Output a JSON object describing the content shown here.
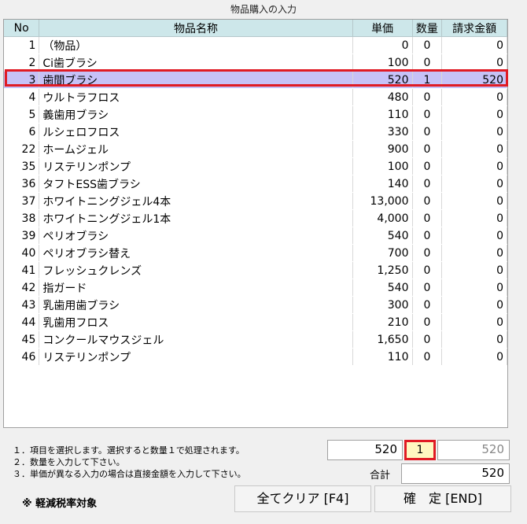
{
  "window": {
    "title": "物品購入の入力"
  },
  "grid": {
    "headers": {
      "no": "No",
      "name": "物品名称",
      "price": "単価",
      "qty": "数量",
      "amount": "請求金額"
    },
    "selected_index": 2,
    "rows": [
      {
        "no": "1",
        "name": "（物品）",
        "price": "0",
        "qty": "0",
        "amount": "0"
      },
      {
        "no": "2",
        "name": "Ci歯ブラシ",
        "price": "100",
        "qty": "0",
        "amount": "0"
      },
      {
        "no": "3",
        "name": "歯間ブラシ",
        "price": "520",
        "qty": "1",
        "amount": "520"
      },
      {
        "no": "4",
        "name": "ウルトラフロス",
        "price": "480",
        "qty": "0",
        "amount": "0"
      },
      {
        "no": "5",
        "name": "義歯用ブラシ",
        "price": "110",
        "qty": "0",
        "amount": "0"
      },
      {
        "no": "6",
        "name": "ルシェロフロス",
        "price": "330",
        "qty": "0",
        "amount": "0"
      },
      {
        "no": "22",
        "name": "ホームジェル",
        "price": "900",
        "qty": "0",
        "amount": "0"
      },
      {
        "no": "35",
        "name": "リステリンポンプ",
        "price": "100",
        "qty": "0",
        "amount": "0"
      },
      {
        "no": "36",
        "name": "タフトESS歯ブラシ",
        "price": "140",
        "qty": "0",
        "amount": "0"
      },
      {
        "no": "37",
        "name": "ホワイトニングジェル4本",
        "price": "13,000",
        "qty": "0",
        "amount": "0"
      },
      {
        "no": "38",
        "name": "ホワイトニングジェル1本",
        "price": "4,000",
        "qty": "0",
        "amount": "0"
      },
      {
        "no": "39",
        "name": "ペリオブラシ",
        "price": "540",
        "qty": "0",
        "amount": "0"
      },
      {
        "no": "40",
        "name": "ペリオブラシ替え",
        "price": "700",
        "qty": "0",
        "amount": "0"
      },
      {
        "no": "41",
        "name": "フレッシュクレンズ",
        "price": "1,250",
        "qty": "0",
        "amount": "0"
      },
      {
        "no": "42",
        "name": "指ガード",
        "price": "540",
        "qty": "0",
        "amount": "0"
      },
      {
        "no": "43",
        "name": "乳歯用歯ブラシ",
        "price": "300",
        "qty": "0",
        "amount": "0"
      },
      {
        "no": "44",
        "name": "乳歯用フロス",
        "price": "210",
        "qty": "0",
        "amount": "0"
      },
      {
        "no": "45",
        "name": "コンクールマウスジェル",
        "price": "1,650",
        "qty": "0",
        "amount": "0"
      },
      {
        "no": "46",
        "name": "リステリンポンプ",
        "price": "110",
        "qty": "0",
        "amount": "0"
      }
    ]
  },
  "instructions": [
    "１．項目を選択します。選択すると数量１で処理されます。",
    "２．数量を入力して下さい。",
    "３．単価が異なる入力の場合は直接金額を入力して下さい。"
  ],
  "entry": {
    "unit_price": "520",
    "quantity": "1",
    "amount": "520"
  },
  "total": {
    "label": "合計",
    "value": "520"
  },
  "tax_note": "※  軽減税率対象",
  "buttons": {
    "clear": "全てクリア [F4]",
    "confirm": "確　定 [END]"
  },
  "colors": {
    "header_bg": "#cde7ea",
    "selected_row_bg": "#c6c2f7",
    "highlight_border": "#e01b24",
    "qty_box_bg": "#fff7c0"
  }
}
